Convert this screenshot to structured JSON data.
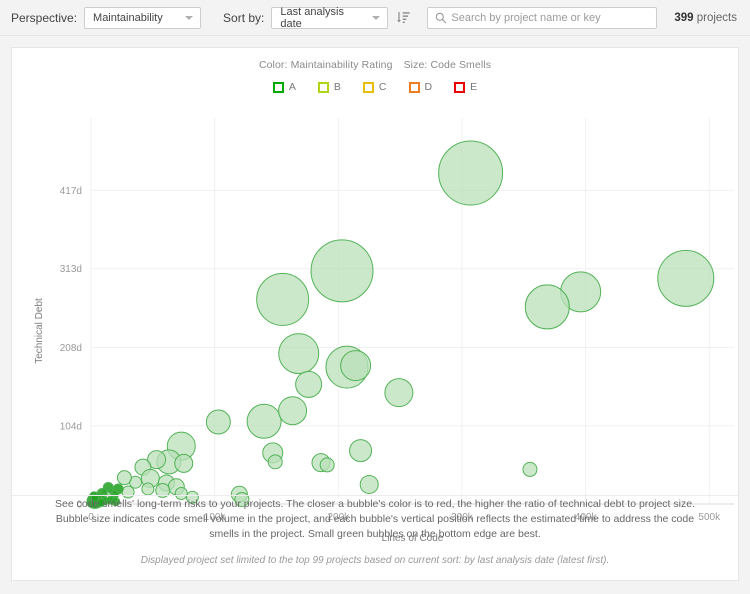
{
  "toolbar": {
    "perspective_label": "Perspective:",
    "perspective_value": "Maintainability",
    "sort_label": "Sort by:",
    "sort_value": "Last analysis date",
    "sort_order_icon": "sort-descending-icon",
    "search_icon": "search-icon",
    "search_placeholder": "Search by project name or key",
    "search_value": "",
    "count_number": "399",
    "count_suffix": " projects"
  },
  "legend": {
    "color_title": "Color: Maintainability Rating",
    "size_title": "Size: Code Smells",
    "items": [
      {
        "label": "A",
        "color": "#00aa00"
      },
      {
        "label": "B",
        "color": "#b0d513"
      },
      {
        "label": "C",
        "color": "#eabe06"
      },
      {
        "label": "D",
        "color": "#ed7d20"
      },
      {
        "label": "E",
        "color": "#ee0000"
      }
    ]
  },
  "footer": {
    "description": "See code smells' long-term risks to your projects. The closer a bubble's color is to red, the higher the ratio of technical debt to project size. Bubble size indicates code smell volume in the project, and each bubble's vertical position reflects the estimated time to address the code smells in the project. Small green bubbles on the bottom edge are best.",
    "limit_note": "Displayed project set limited to the top 99 projects based on current sort: by last analysis date (latest first)."
  },
  "chart_data": {
    "type": "scatter",
    "title": "",
    "xlabel": "Lines of Code",
    "ylabel": "Technical Debt",
    "xlim": [
      0,
      520000
    ],
    "ylim": [
      0,
      460
    ],
    "grid": true,
    "legend_position": "top-center",
    "xticks": [
      0,
      100000,
      200000,
      300000,
      400000,
      500000
    ],
    "xticklabels": [
      "0",
      "100k",
      "200k",
      "300k",
      "400k",
      "500k"
    ],
    "yticks": [
      0,
      104,
      208,
      313,
      417
    ],
    "yticklabels": [
      "0",
      "104d",
      "208d",
      "313d",
      "417d"
    ],
    "bubble_fill": "#b9e0b9",
    "bubble_stroke": "#4caf50",
    "bubble_fill_dense": "#23a324",
    "bubble_opacity": 0.75,
    "series": [
      {
        "name": "Projects",
        "rating": "A",
        "points": [
          {
            "x": 307000,
            "y": 440,
            "r": 32
          },
          {
            "x": 481000,
            "y": 300,
            "r": 28
          },
          {
            "x": 203000,
            "y": 310,
            "r": 31
          },
          {
            "x": 155000,
            "y": 272,
            "r": 26
          },
          {
            "x": 396000,
            "y": 282,
            "r": 20
          },
          {
            "x": 369000,
            "y": 262,
            "r": 22
          },
          {
            "x": 168000,
            "y": 200,
            "r": 20
          },
          {
            "x": 207000,
            "y": 182,
            "r": 21
          },
          {
            "x": 214000,
            "y": 184,
            "r": 15
          },
          {
            "x": 249000,
            "y": 148,
            "r": 14
          },
          {
            "x": 176000,
            "y": 159,
            "r": 13
          },
          {
            "x": 140000,
            "y": 110,
            "r": 17
          },
          {
            "x": 163000,
            "y": 124,
            "r": 14
          },
          {
            "x": 103000,
            "y": 109,
            "r": 12
          },
          {
            "x": 147000,
            "y": 68,
            "r": 10
          },
          {
            "x": 149000,
            "y": 56,
            "r": 7
          },
          {
            "x": 73000,
            "y": 77,
            "r": 14
          },
          {
            "x": 63000,
            "y": 56,
            "r": 12
          },
          {
            "x": 75000,
            "y": 54,
            "r": 9
          },
          {
            "x": 53000,
            "y": 59,
            "r": 9
          },
          {
            "x": 42000,
            "y": 49,
            "r": 8
          },
          {
            "x": 48000,
            "y": 34,
            "r": 9
          },
          {
            "x": 61000,
            "y": 28,
            "r": 8
          },
          {
            "x": 69000,
            "y": 23,
            "r": 8
          },
          {
            "x": 58000,
            "y": 18,
            "r": 7
          },
          {
            "x": 73000,
            "y": 14,
            "r": 6
          },
          {
            "x": 82000,
            "y": 9,
            "r": 6
          },
          {
            "x": 46000,
            "y": 20,
            "r": 6
          },
          {
            "x": 36000,
            "y": 29,
            "r": 6
          },
          {
            "x": 27000,
            "y": 35,
            "r": 7
          },
          {
            "x": 120000,
            "y": 13,
            "r": 8
          },
          {
            "x": 122000,
            "y": 6,
            "r": 7
          },
          {
            "x": 355000,
            "y": 46,
            "r": 7
          },
          {
            "x": 186000,
            "y": 55,
            "r": 9
          },
          {
            "x": 191000,
            "y": 52,
            "r": 7
          },
          {
            "x": 218000,
            "y": 71,
            "r": 11
          },
          {
            "x": 225000,
            "y": 26,
            "r": 9
          },
          {
            "x": 30000,
            "y": 16,
            "r": 6
          },
          {
            "x": 22000,
            "y": 20,
            "r": 5
          },
          {
            "x": 18000,
            "y": 12,
            "r": 5
          },
          {
            "x": 14000,
            "y": 22,
            "r": 5
          },
          {
            "x": 12000,
            "y": 9,
            "r": 6
          },
          {
            "x": 9000,
            "y": 14,
            "r": 5
          },
          {
            "x": 7500,
            "y": 7,
            "r": 5
          },
          {
            "x": 11000,
            "y": 4,
            "r": 4
          },
          {
            "x": 16000,
            "y": 5,
            "r": 4
          },
          {
            "x": 20000,
            "y": 3,
            "r": 4
          },
          {
            "x": 6000,
            "y": 4,
            "r": 5
          },
          {
            "x": 4500,
            "y": 9,
            "r": 5
          },
          {
            "x": 3500,
            "y": 5,
            "r": 5
          },
          {
            "x": 2800,
            "y": 3,
            "r": 5
          },
          {
            "x": 2200,
            "y": 7,
            "r": 5
          },
          {
            "x": 1800,
            "y": 4,
            "r": 5
          },
          {
            "x": 1500,
            "y": 2,
            "r": 5
          },
          {
            "x": 1200,
            "y": 6,
            "r": 4
          },
          {
            "x": 1000,
            "y": 3,
            "r": 4
          },
          {
            "x": 900,
            "y": 1,
            "r": 4
          },
          {
            "x": 800,
            "y": 5,
            "r": 4
          },
          {
            "x": 700,
            "y": 2,
            "r": 4
          },
          {
            "x": 600,
            "y": 4,
            "r": 4
          },
          {
            "x": 500,
            "y": 1,
            "r": 4
          },
          {
            "x": 450,
            "y": 3,
            "r": 4
          },
          {
            "x": 400,
            "y": 6,
            "r": 4
          },
          {
            "x": 350,
            "y": 2,
            "r": 4
          },
          {
            "x": 300,
            "y": 4,
            "r": 4
          },
          {
            "x": 250,
            "y": 1,
            "r": 4
          },
          {
            "x": 200,
            "y": 3,
            "r": 4
          },
          {
            "x": 180,
            "y": 5,
            "r": 4
          },
          {
            "x": 150,
            "y": 2,
            "r": 4
          },
          {
            "x": 120,
            "y": 4,
            "r": 4
          },
          {
            "x": 100,
            "y": 1,
            "r": 4
          },
          {
            "x": 3000,
            "y": 1,
            "r": 5
          },
          {
            "x": 5000,
            "y": 2,
            "r": 5
          },
          {
            "x": 2000,
            "y": 1,
            "r": 5
          },
          {
            "x": 4000,
            "y": 1,
            "r": 5
          },
          {
            "x": 6500,
            "y": 1,
            "r": 4
          },
          {
            "x": 8000,
            "y": 2,
            "r": 4
          },
          {
            "x": 1600,
            "y": 9,
            "r": 4
          },
          {
            "x": 2400,
            "y": 11,
            "r": 4
          },
          {
            "x": 3200,
            "y": 8,
            "r": 4
          }
        ]
      }
    ]
  }
}
